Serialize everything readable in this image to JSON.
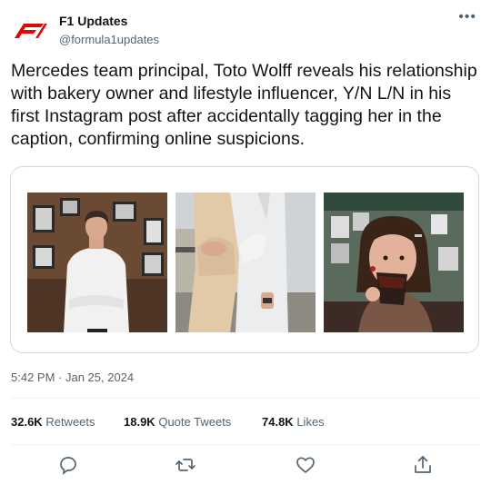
{
  "author": {
    "name": "F1 Updates",
    "handle": "@formula1updates",
    "avatar_icon": "f1-logo-icon",
    "brand_color": "#e10600"
  },
  "more_icon": "more-options-icon",
  "tweet": {
    "text": "Mercedes team principal, Toto Wolff reveals his relationship with bakery owner and lifestyle influencer, Y/N L/N in his first Instagram post after accidentally tagging her in the caption, confirming online suspicions."
  },
  "media": [
    {
      "icon": "photo-man-in-office"
    },
    {
      "icon": "photo-couple-embracing"
    },
    {
      "icon": "photo-woman-drinking"
    }
  ],
  "timestamp": "5:42 PM · Jan 25, 2024",
  "stats": {
    "retweets_count": "32.6K",
    "retweets_label": "Retweets",
    "quotes_count": "18.9K",
    "quotes_label": "Quote Tweets",
    "likes_count": "74.8K",
    "likes_label": "Likes"
  },
  "actions": [
    "reply-icon",
    "retweet-icon",
    "like-icon",
    "share-icon"
  ],
  "colors": {
    "secondary_text": "#536471",
    "border": "#cfd9de",
    "divider": "#eff3f4"
  }
}
